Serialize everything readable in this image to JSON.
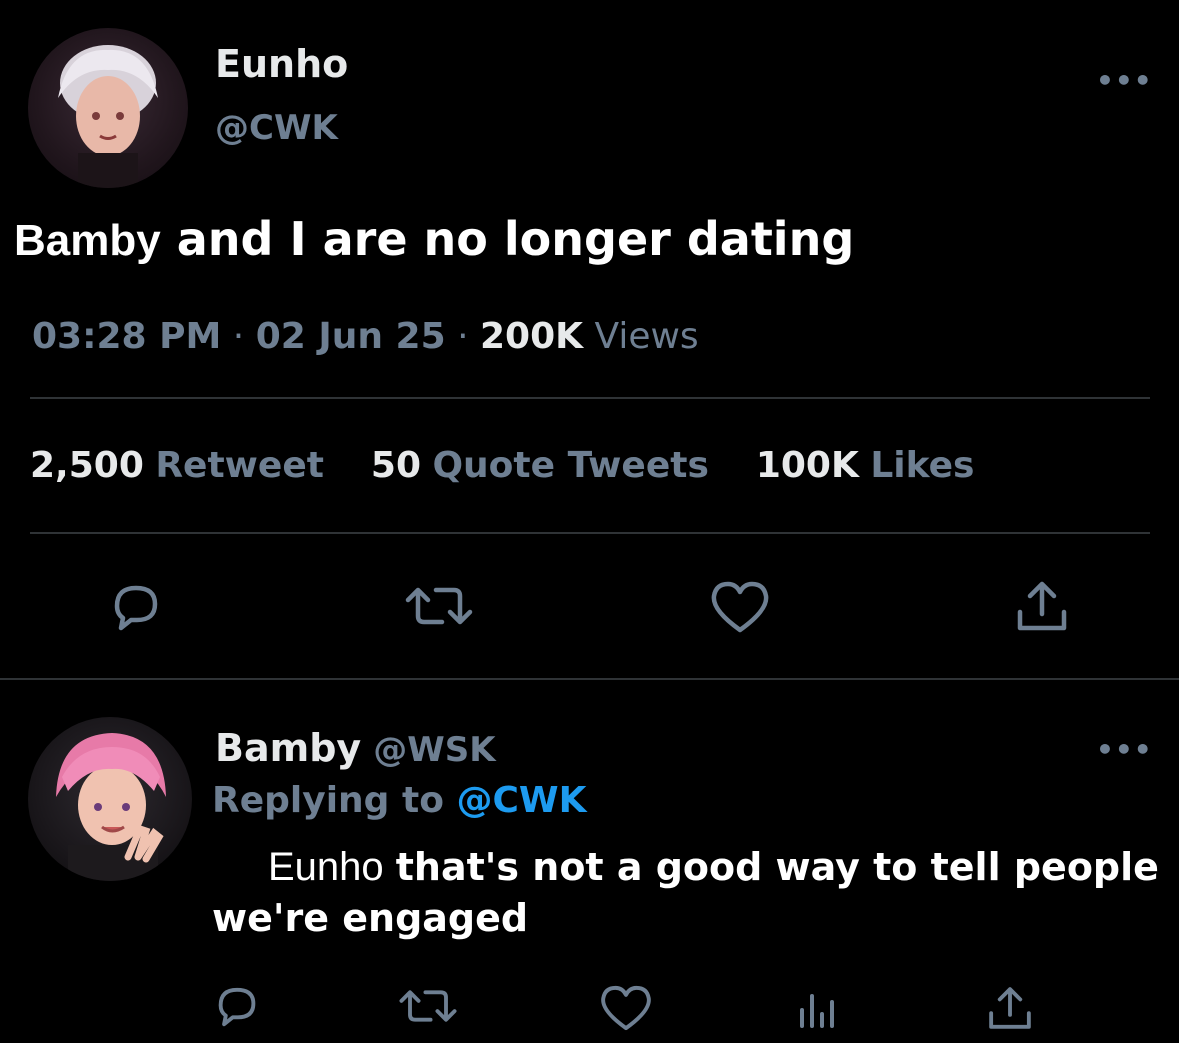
{
  "tweet": {
    "author_name": "Eunho",
    "author_handle": "@CWK",
    "text_name": "Bamby",
    "text_rest": "and I are no longer dating",
    "time": "03:28 PM",
    "sep1": "·",
    "date": "02 Jun 25",
    "sep2": "·",
    "views_count": "200K",
    "views_label": "Views",
    "retweets_count": "2,500",
    "retweets_label": "Retweet",
    "quotes_count": "50",
    "quotes_label": "Quote Tweets",
    "likes_count": "100K",
    "likes_label": "Likes",
    "more": "•••"
  },
  "reply": {
    "author_name": "Bamby",
    "author_handle": "@WSK",
    "replying_label": "Replying to",
    "replying_handle": "@CWK",
    "text_name": "Eunho",
    "text_line1_rest": "that's not a good way to tell people",
    "text_line2": "we're engaged",
    "more": "•••"
  },
  "icons": {
    "reply": "reply-icon",
    "retweet": "retweet-icon",
    "like": "heart-icon",
    "analytics": "analytics-icon",
    "share": "share-icon"
  },
  "colors": {
    "background": "#000000",
    "text": "#ffffff",
    "muted": "#6e7f92",
    "link": "#1d9bf0",
    "divider": "#2f3336"
  }
}
